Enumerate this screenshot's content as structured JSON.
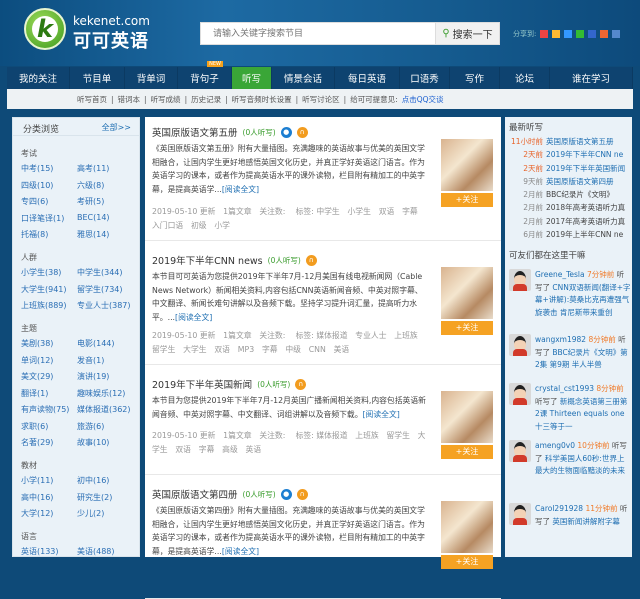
{
  "header": {
    "domain": "kekenet.com",
    "brand": "可可英语",
    "search_placeholder": "请输入关键字搜索节目",
    "search_button": "搜索一下",
    "share_label": "分享到:"
  },
  "nav": [
    {
      "label": "我的关注"
    },
    {
      "label": "节目单"
    },
    {
      "label": "背单词"
    },
    {
      "label": "背句子",
      "badge": "NEW"
    },
    {
      "label": "听写",
      "active": true
    },
    {
      "label": "情景会话"
    },
    {
      "label": "每日英语"
    },
    {
      "label": "口语秀"
    },
    {
      "label": "写作"
    },
    {
      "label": "论坛"
    },
    {
      "label": "谁在学习"
    }
  ],
  "subnav": [
    "听写首页",
    "|",
    "错词本",
    "|",
    "听写成绩",
    "|",
    "历史记录",
    "|",
    "听写音频时长设置",
    "|",
    "听写讨论区",
    "|",
    "给可可提意见:"
  ],
  "subnav_link": "点击QQ交谈",
  "sidebar": {
    "title": "分类浏览",
    "all": "全部>>",
    "sections": [
      {
        "title": "考试",
        "items": [
          "中考(15)",
          "高考(11)",
          "四级(10)",
          "六级(8)",
          "专四(6)",
          "考研(5)",
          "口译笔译(1)",
          "BEC(14)",
          "托福(8)",
          "雅思(14)"
        ]
      },
      {
        "title": "人群",
        "items": [
          "小学生(38)",
          "中学生(344)",
          "大学生(941)",
          "留学生(734)",
          "上班族(889)",
          "专业人士(387)"
        ]
      },
      {
        "title": "主题",
        "items": [
          "美剧(38)",
          "电影(144)",
          "单词(12)",
          "发音(1)",
          "美文(29)",
          "演讲(19)",
          "翻译(1)",
          "趣味娱乐(12)",
          "有声读物(75)",
          "媒体报道(362)",
          "求职(6)",
          "旅游(6)",
          "名著(29)",
          "故事(10)"
        ]
      },
      {
        "title": "教材",
        "items": [
          "小学(11)",
          "初中(16)",
          "高中(16)",
          "研究生(2)",
          "大学(12)",
          "少儿(2)"
        ]
      },
      {
        "title": "语言",
        "items": [
          "英语(133)",
          "美语(488)"
        ]
      }
    ]
  },
  "programs": [
    {
      "title": "英国原版语文第五册",
      "count": "(0人听写)",
      "desc": "《英国原版语文第五册》附有大量插图。充满趣味的英语故事与优美的英国文学相融合，让国内学生更好地感悟英国文化历史，并真正学好英语这门语言。作为英语学习的课本，或者作为提高英语水平的课外读物，栏目附有精加工的中英字幕，是提高英语学...",
      "read_more": "[阅读全文]",
      "meta": "2019-05-10 更新　1篇文章　关注数:　 标签: 中学生　小学生　双语　字幕　入门口语　初级　小学",
      "follow": "+关注"
    },
    {
      "title": "2019年下半年CNN news",
      "count": "(0人听写)",
      "desc": "本节目可可英语为您提供2019年下半年7月-12月美国有线电视新闻网（Cable News Network）新闻相关资料,内容包括CNN英语新闻音频、中英对照字幕、中文翻译、新闻长难句讲解以及音频下载。坚持学习提升词汇量，提高听力水平。...",
      "read_more": "[阅读全文]",
      "meta": "2019-05-10 更新　1篇文章　关注数:　 标签: 媒体报道　专业人士　上班族　留学生　大学生　双语　MP3　字幕　中级　CNN　美语",
      "follow": "+关注"
    },
    {
      "title": "2019年下半年英国新闻",
      "count": "(0人听写)",
      "desc": "本节目为您提供2019年下半年7月-12月英国广播新闻相关资料,内容包括英语新闻音频、中英对照字幕、中文翻译、词组讲解以及音频下载。",
      "read_more": "[阅读全文]",
      "meta": "2019-05-10 更新　1篇文章　关注数:　 标签: 媒体报道　上班族　留学生　大学生　双语　字幕　高级　英语",
      "follow": "+关注"
    },
    {
      "title": "英国原版语文第四册",
      "count": "(0人听写)",
      "desc": "《英国原版语文第四册》附有大量插图。充满趣味的英语故事与优美的英国文学相融合，让国内学生更好地感悟英国文化历史，并真正学好英语这门语言。作为英语学习的课本，或者作为提高英语水平的课外读物，栏目附有精加工的中英字幕，是提高英语学...",
      "read_more": "[阅读全文]",
      "follow": "+关注"
    }
  ],
  "latest": {
    "title": "最新听写",
    "items": [
      {
        "time": "11小时前",
        "title": "英国原版语文第五册"
      },
      {
        "time": "2天前",
        "title": "2019年下半年CNN ne"
      },
      {
        "time": "2天前",
        "title": "2019年下半年英国新闻"
      },
      {
        "time": "9天前",
        "title": "英国原版语文第四册"
      },
      {
        "time": "2月前",
        "title": "BBC纪录片《文明》"
      },
      {
        "time": "2月前",
        "title": "2018年高考英语听力真"
      },
      {
        "time": "2月前",
        "title": "2017年高考英语听力真"
      },
      {
        "time": "6月前",
        "title": "2019年上半年CNN ne"
      }
    ]
  },
  "activity": {
    "title": "可友们都在这里干嘛",
    "items": [
      {
        "user": "Greene_Tesla",
        "time": "7分钟前",
        "verb": "听写了",
        "target": "CNN双语新闻(翻译+字幕+讲解):莫桑比克再遭强气旋袭击 肯尼斯带来重创"
      },
      {
        "user": "wangxm1982",
        "time": "8分钟前",
        "verb": "听写了",
        "target": "BBC纪录片《文明》第2集 第9期 半人半兽"
      },
      {
        "user": "crystal_cst1993",
        "time": "8分钟前",
        "verb": "听写了",
        "target": "新概念英语第三册第2课 Thirteen equals one 十三等于一"
      },
      {
        "user": "ameng0v0",
        "time": "10分钟前",
        "verb": "听写了",
        "target": "科学美国人60秒:世界上最大的生物面临黯淡的未来"
      },
      {
        "user": "Carol291928",
        "time": "11分钟前",
        "verb": "听写了",
        "target": "英国新闻讲解附字幕"
      }
    ]
  }
}
